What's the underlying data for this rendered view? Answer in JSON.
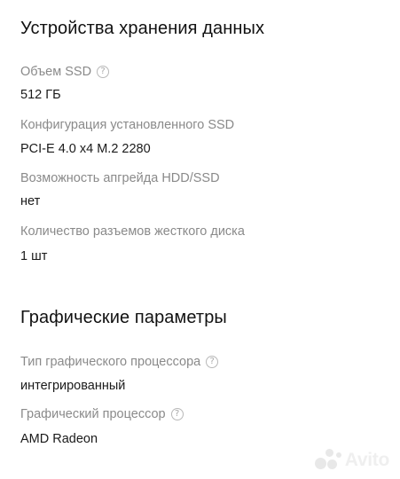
{
  "sections": [
    {
      "title": "Устройства хранения данных",
      "specs": [
        {
          "label": "Объем SSD",
          "value": "512 ГБ",
          "help_icon": "question-circle-icon"
        },
        {
          "label": "Конфигурация установленного SSD",
          "value": "PCI-E 4.0 x4 M.2 2280"
        },
        {
          "label": "Возможность апгрейда HDD/SSD",
          "value": "нет"
        },
        {
          "label": "Количество разъемов жесткого диска",
          "value": "1 шт"
        }
      ]
    },
    {
      "title": "Графические параметры",
      "specs": [
        {
          "label": "Тип графического процессора",
          "value": "интегрированный",
          "help_icon": "question-circle-icon"
        },
        {
          "label": "Графический процессор",
          "value": "AMD Radeon",
          "help_icon": "question-circle-icon"
        }
      ]
    }
  ],
  "help_icon_glyph": "?",
  "watermark": {
    "text": "Avito"
  }
}
